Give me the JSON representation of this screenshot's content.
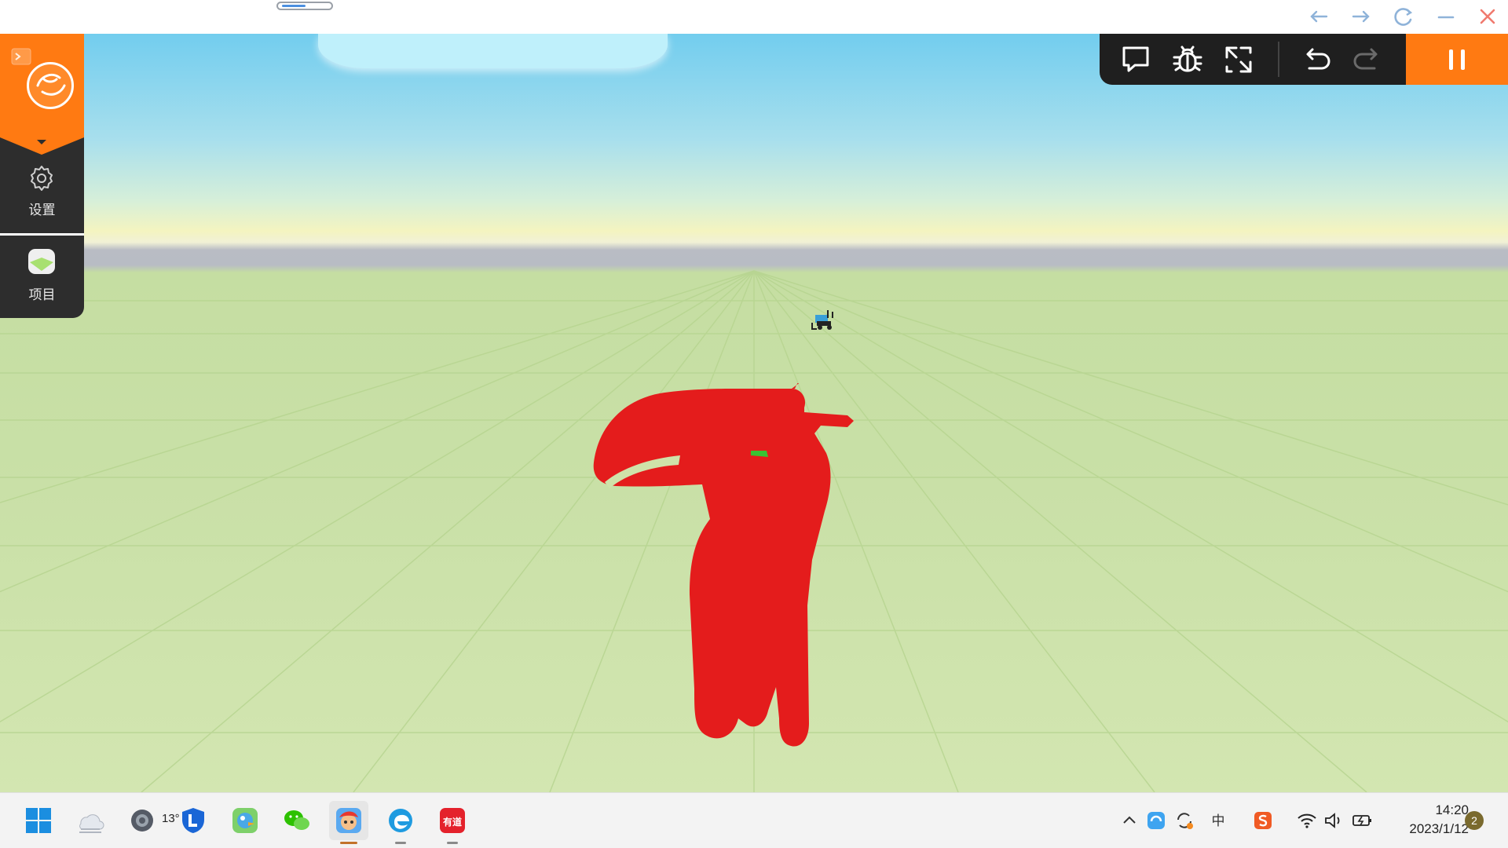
{
  "window": {
    "controls": [
      "back-icon",
      "forward-icon",
      "refresh-icon",
      "minimize-icon",
      "close-icon"
    ]
  },
  "sidebar": {
    "items": [
      {
        "label": "设置",
        "icon": "gear-icon"
      },
      {
        "label": "项目",
        "icon": "project-icon"
      }
    ]
  },
  "toolbar": {
    "tools": [
      "comment-icon",
      "debug-bug-icon",
      "fullscreen-icon",
      "undo-icon",
      "redo-icon"
    ],
    "primary": "pause-icon",
    "accent": "#ff7a12"
  },
  "taskbar": {
    "weather_temp": "13°",
    "apps": [
      "start-icon",
      "weather-icon",
      "settings-icon",
      "shield-l-icon",
      "bird-app-icon",
      "wechat-icon",
      "game-editor-icon",
      "edge-icon",
      "youdao-icon"
    ],
    "youdao_label": "有道",
    "tray": {
      "ime_label": "中",
      "time": "14:20",
      "date": "2023/1/12",
      "notifications": "2"
    }
  }
}
